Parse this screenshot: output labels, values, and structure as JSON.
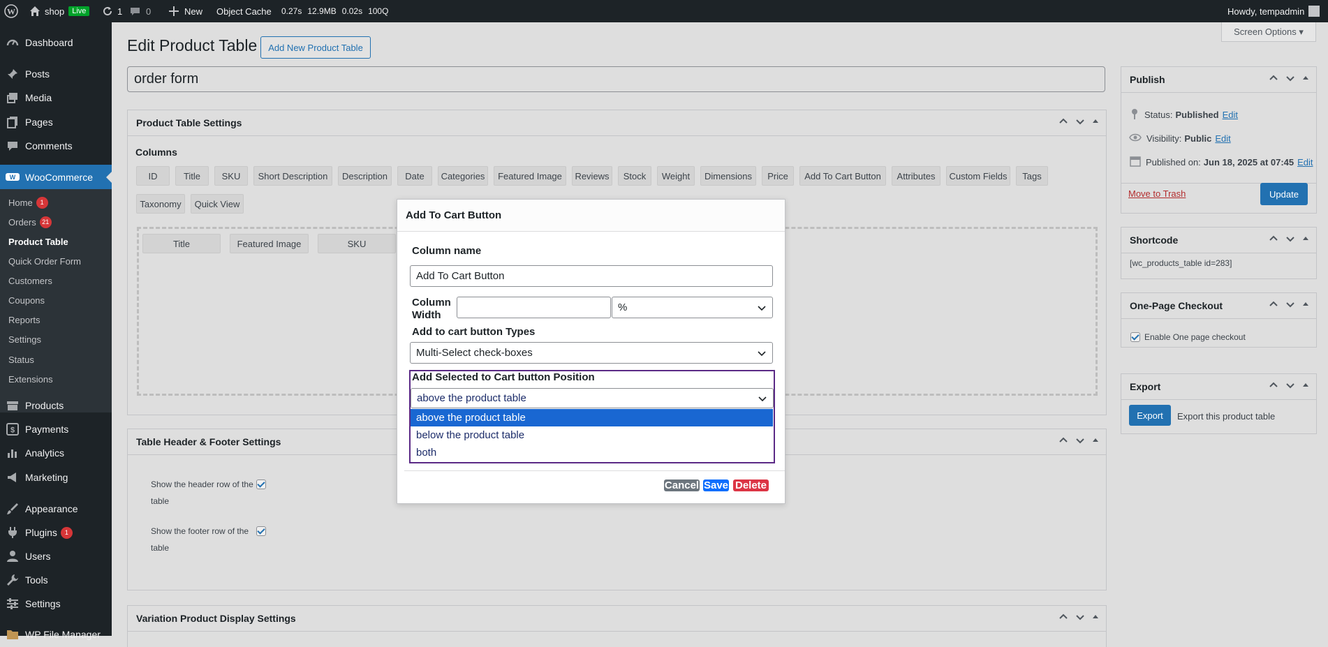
{
  "admin_bar": {
    "site_name": "shop",
    "live_label": "Live",
    "updates_count": "1",
    "comments_count": "0",
    "new_label": "New",
    "object_cache_label": "Object Cache",
    "qm_time": "0.27s",
    "qm_memory": "12.9MB",
    "qm_db_time": "0.02s",
    "qm_queries": "100Q",
    "howdy": "Howdy, tempadmin"
  },
  "sidebar": {
    "dashboard": "Dashboard",
    "posts": "Posts",
    "media": "Media",
    "pages": "Pages",
    "comments": "Comments",
    "woocommerce": "WooCommerce",
    "woo_sub": {
      "home": "Home",
      "home_badge": "1",
      "orders": "Orders",
      "orders_badge": "21",
      "product_table": "Product Table",
      "quick_order_form": "Quick Order Form",
      "customers": "Customers",
      "coupons": "Coupons",
      "reports": "Reports",
      "settings": "Settings",
      "status": "Status",
      "extensions": "Extensions"
    },
    "products": "Products",
    "payments": "Payments",
    "analytics": "Analytics",
    "marketing": "Marketing",
    "appearance": "Appearance",
    "plugins": "Plugins",
    "plugins_badge": "1",
    "users": "Users",
    "tools": "Tools",
    "settings": "Settings",
    "wp_file_manager": "WP File Manager"
  },
  "screen_options": "Screen Options ▾",
  "page": {
    "title": "Edit Product Table",
    "add_new_label": "Add New Product Table",
    "post_title_value": "order form"
  },
  "settings_box": {
    "title": "Product Table Settings",
    "columns_label": "Columns",
    "available_columns": [
      "ID",
      "Title",
      "SKU",
      "Short Description",
      "Description",
      "Date",
      "Categories",
      "Featured Image",
      "Reviews",
      "Stock",
      "Weight",
      "Dimensions",
      "Price",
      "Add To Cart Button",
      "Attributes",
      "Custom Fields",
      "Tags"
    ],
    "available_columns_row2": [
      "Taxonomy",
      "Quick View"
    ],
    "selected_columns": [
      "Title",
      "Featured Image",
      "SKU"
    ]
  },
  "header_footer_box": {
    "title": "Table Header & Footer Settings",
    "header_label_line1": "Show the header row of the",
    "header_label_line2": "table",
    "footer_label_line1": "Show the footer row of the",
    "footer_label_line2": "table"
  },
  "variation_box": {
    "title": "Variation Product Display Settings"
  },
  "publish_box": {
    "title": "Publish",
    "status_label": "Status:",
    "status_value": "Published",
    "visibility_label": "Visibility:",
    "visibility_value": "Public",
    "published_on_label": "Published on:",
    "published_on_value": "Jun 18, 2025 at 07:45",
    "edit_label": "Edit",
    "trash_label": "Move to Trash",
    "update_label": "Update"
  },
  "shortcode_box": {
    "title": "Shortcode",
    "shortcode": "[wc_products_table id=283]"
  },
  "checkout_box": {
    "title": "One-Page Checkout",
    "enable_label": "Enable One page checkout"
  },
  "export_box": {
    "title": "Export",
    "button_label": "Export",
    "description": "Export this product table"
  },
  "modal": {
    "title": "Add To Cart Button",
    "column_name_label": "Column name",
    "column_name_value": "Add To Cart Button",
    "column_width_label_line1": "Column",
    "column_width_label_line2": "Width",
    "column_width_value": "",
    "width_unit": "%",
    "button_types_label": "Add to cart button Types",
    "button_types_value": "Multi-Select check-boxes",
    "position_label": "Add Selected to Cart button Position",
    "position_value": "above the product table",
    "position_options": [
      "above the product table",
      "below the product table",
      "both"
    ],
    "cancel_label": "Cancel",
    "save_label": "Save",
    "delete_label": "Delete"
  },
  "colors": {
    "accent": "#2271b1",
    "admin_dark": "#1d2327",
    "badge_red": "#d63638",
    "live_green": "#00a32a",
    "dropdown_highlight": "#1967d2",
    "focus_purple": "#5b2a86",
    "delete_red": "#dc3545",
    "save_blue": "#0d6efd",
    "cancel_gray": "#6c757d"
  }
}
